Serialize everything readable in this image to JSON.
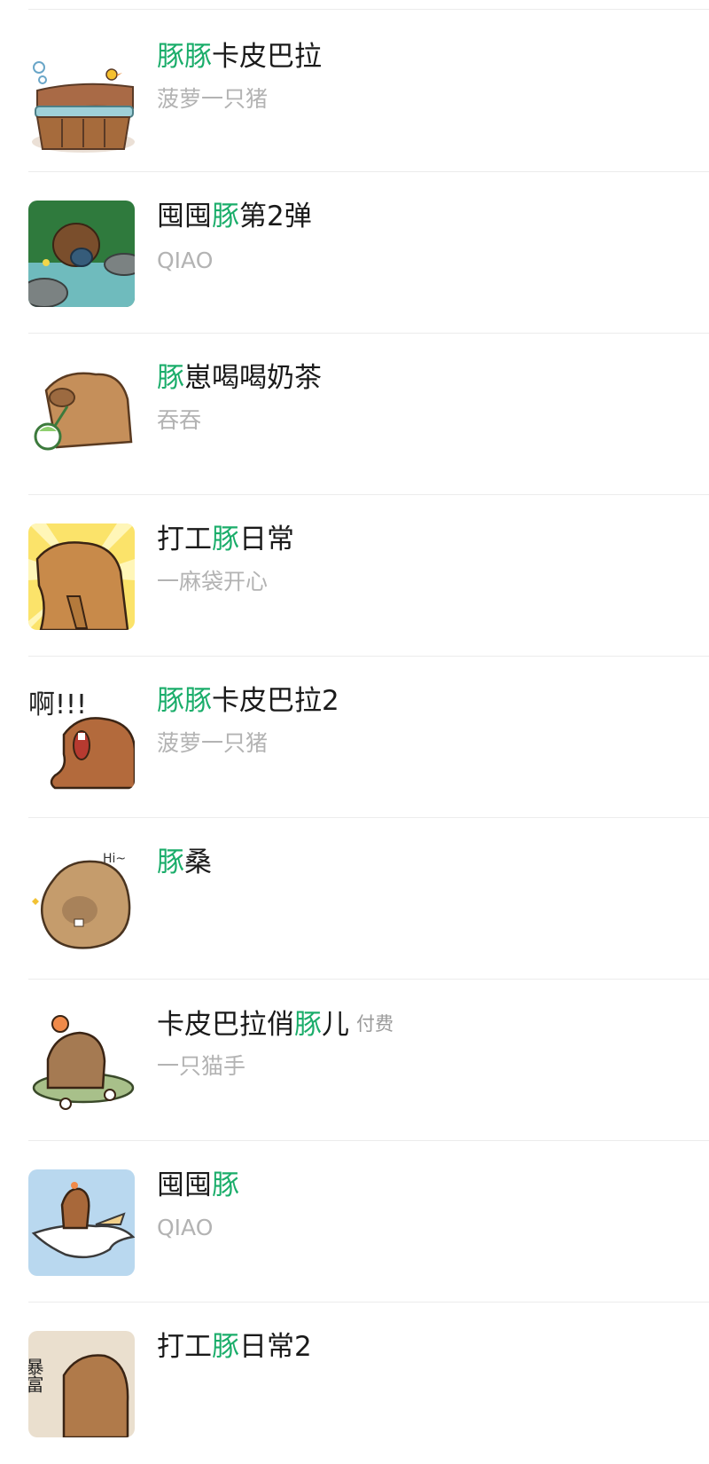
{
  "colors": {
    "highlight": "#1aad6a",
    "title": "#1a1a1a",
    "subtitle": "#b3b3b3",
    "divider": "#ececec"
  },
  "items": [
    {
      "pre": "",
      "hl": "豚豚",
      "post": "卡皮巴拉",
      "badge": "",
      "author": "菠萝一只猪",
      "thumb_icon": "capybara-bath-icon"
    },
    {
      "pre": "囤囤",
      "hl": "豚",
      "post": "第2弹",
      "badge": "",
      "author": "QIAO",
      "thumb_icon": "capybara-pond-icon"
    },
    {
      "pre": "",
      "hl": "豚",
      "post": "崽喝喝奶茶",
      "badge": "",
      "author": "吞吞",
      "thumb_icon": "capybara-milktea-icon"
    },
    {
      "pre": "打工",
      "hl": "豚",
      "post": "日常",
      "badge": "",
      "author": "一麻袋开心",
      "thumb_icon": "capybara-pray-icon"
    },
    {
      "pre": "",
      "hl": "豚豚",
      "post": "卡皮巴拉2",
      "badge": "",
      "author": "菠萝一只猪",
      "thumb_icon": "capybara-shout-icon"
    },
    {
      "pre": "",
      "hl": "豚",
      "post": "桑",
      "badge": "",
      "author": "",
      "thumb_icon": "capybara-hi-icon"
    },
    {
      "pre": "卡皮巴拉俏",
      "hl": "豚",
      "post": "儿",
      "badge": "付费",
      "author": "一只猫手",
      "thumb_icon": "capybara-skate-icon"
    },
    {
      "pre": "囤囤",
      "hl": "豚",
      "post": "",
      "badge": "",
      "author": "QIAO",
      "thumb_icon": "capybara-bird-icon"
    },
    {
      "pre": "打工",
      "hl": "豚",
      "post": "日常2",
      "badge": "",
      "author": "",
      "thumb_icon": "capybara-work2-icon"
    }
  ],
  "thumb_text": {
    "shout": "啊!!!",
    "hi": "Hi~",
    "work2": "暴富"
  }
}
